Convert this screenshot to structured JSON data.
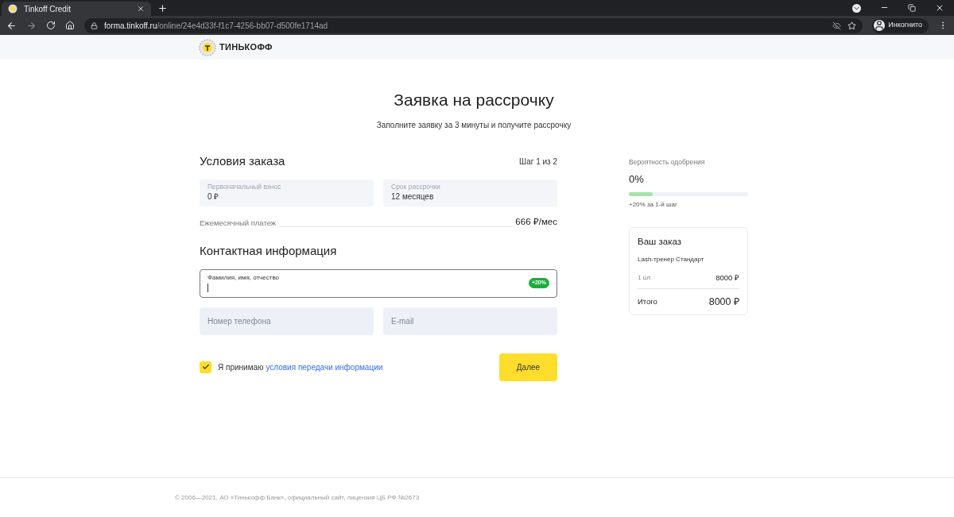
{
  "browser": {
    "tab_title": "Tinkoff Credit",
    "url_host": "forma.tinkoff.ru",
    "url_path": "/online/24e4d33f-f1c7-4256-bb07-d500fe1714ad",
    "profile": "Инкогнито"
  },
  "header": {
    "logo_text": "ТИНЬКОФФ"
  },
  "title": "Заявка на рассрочку",
  "subtitle": "Заполните заявку за 3 минуты и получите рассрочку",
  "conditions": {
    "heading": "Условия заказа",
    "step": "Шаг 1 из 2",
    "fields": [
      {
        "label": "Первоначальный взнос",
        "value": "0 ₽"
      },
      {
        "label": "Срок рассрочки",
        "value": "12 месяцев"
      }
    ],
    "monthly": {
      "label": "Ежемесячный платеж",
      "value": "666 ₽/мес"
    }
  },
  "contact": {
    "heading": "Контактная информация",
    "name_field": {
      "label": "Фамилия, имя, отчество",
      "badge": "+20%",
      "focused": true
    },
    "fields": [
      {
        "placeholder": "Номер телефона"
      },
      {
        "placeholder": "E-mail"
      }
    ],
    "consent": {
      "checked": true,
      "text": "Я принимаю",
      "link": "условия передачи информации"
    },
    "next_button": "Далее"
  },
  "approval": {
    "label": "Вероятность одобрения",
    "value": "0%",
    "level": 0.2,
    "hint": "+20% за 1-й шаг"
  },
  "order": {
    "title": "Ваш заказ",
    "item": "Lash-тренер Стандарт",
    "quantity": "1 шт.",
    "price": "8000 ₽",
    "total_label": "Итого",
    "total": "8000 ₽"
  },
  "footer": "© 2006—2021, АО «Тинькофф Банк», официальный сайт, лицензия ЦБ РФ №2673"
}
